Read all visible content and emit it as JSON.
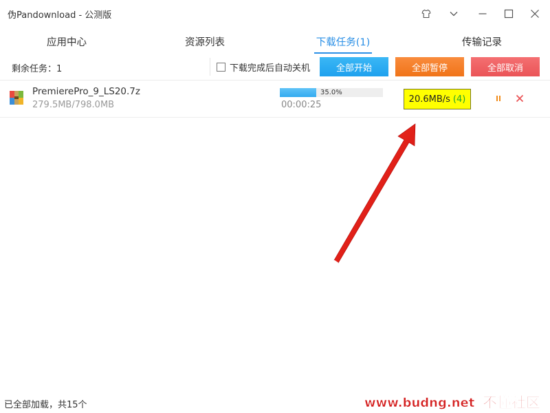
{
  "window": {
    "title": "伪Pandownload - 公测版"
  },
  "title_controls": {
    "skin_icon": "shirt-icon",
    "menu_icon": "chevron-down-icon",
    "minimize_icon": "minimize-icon",
    "maximize_icon": "maximize-icon",
    "close_icon": "close-icon"
  },
  "tabs": [
    {
      "label": "应用中心",
      "active": false
    },
    {
      "label": "资源列表",
      "active": false
    },
    {
      "label": "下载任务(1)",
      "active": true
    },
    {
      "label": "传输记录",
      "active": false
    }
  ],
  "toolbar": {
    "remaining_label": "剩余任务：1",
    "auto_shutdown_label": "下载完成后自动关机",
    "auto_shutdown_checked": false,
    "start_all_label": "全部开始",
    "pause_all_label": "全部暂停",
    "cancel_all_label": "全部取消"
  },
  "downloads": [
    {
      "file_icon": "archive-file-icon",
      "name": "PremierePro_9_LS20.7z",
      "size": "279.5MB/798.0MB",
      "progress": 0.35,
      "progress_text": "35.0%",
      "elapsed": "00:00:25",
      "speed": "20.6MB/s",
      "connections": "(4)",
      "pause_icon": "pause-icon",
      "cancel_icon": "close-icon"
    }
  ],
  "status_bar": {
    "text": "已全部加载，共15个"
  },
  "watermark": {
    "text": "www.budng.net 不懂社区"
  },
  "colors": {
    "accent": "#2a8fe6",
    "start_button": "#1fa1ee",
    "pause_button": "#f07419",
    "cancel_button": "#ea5457",
    "speed_highlight": "#ffff00",
    "arrow": "#e01010"
  }
}
